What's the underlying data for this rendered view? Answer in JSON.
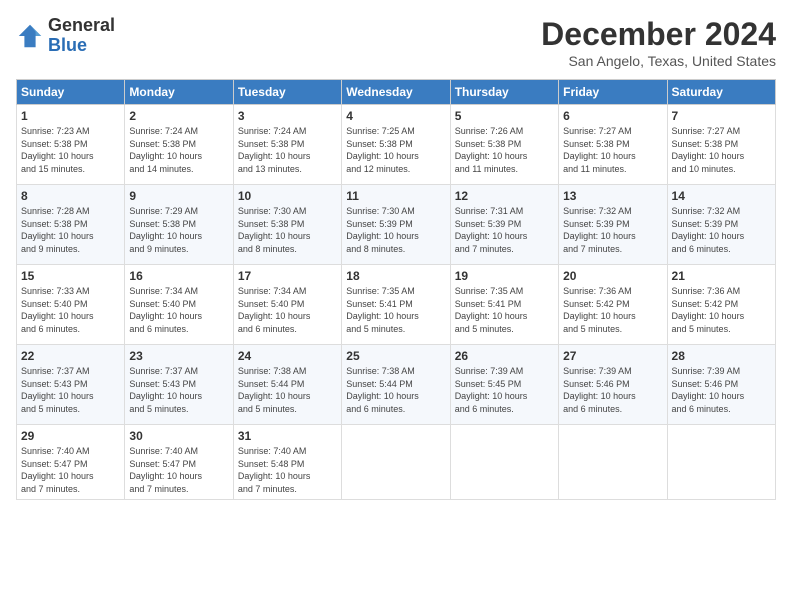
{
  "header": {
    "logo_general": "General",
    "logo_blue": "Blue",
    "month_title": "December 2024",
    "location": "San Angelo, Texas, United States"
  },
  "calendar": {
    "weekdays": [
      "Sunday",
      "Monday",
      "Tuesday",
      "Wednesday",
      "Thursday",
      "Friday",
      "Saturday"
    ],
    "weeks": [
      [
        {
          "day": "1",
          "info": "Sunrise: 7:23 AM\nSunset: 5:38 PM\nDaylight: 10 hours\nand 15 minutes."
        },
        {
          "day": "2",
          "info": "Sunrise: 7:24 AM\nSunset: 5:38 PM\nDaylight: 10 hours\nand 14 minutes."
        },
        {
          "day": "3",
          "info": "Sunrise: 7:24 AM\nSunset: 5:38 PM\nDaylight: 10 hours\nand 13 minutes."
        },
        {
          "day": "4",
          "info": "Sunrise: 7:25 AM\nSunset: 5:38 PM\nDaylight: 10 hours\nand 12 minutes."
        },
        {
          "day": "5",
          "info": "Sunrise: 7:26 AM\nSunset: 5:38 PM\nDaylight: 10 hours\nand 11 minutes."
        },
        {
          "day": "6",
          "info": "Sunrise: 7:27 AM\nSunset: 5:38 PM\nDaylight: 10 hours\nand 11 minutes."
        },
        {
          "day": "7",
          "info": "Sunrise: 7:27 AM\nSunset: 5:38 PM\nDaylight: 10 hours\nand 10 minutes."
        }
      ],
      [
        {
          "day": "8",
          "info": "Sunrise: 7:28 AM\nSunset: 5:38 PM\nDaylight: 10 hours\nand 9 minutes."
        },
        {
          "day": "9",
          "info": "Sunrise: 7:29 AM\nSunset: 5:38 PM\nDaylight: 10 hours\nand 9 minutes."
        },
        {
          "day": "10",
          "info": "Sunrise: 7:30 AM\nSunset: 5:38 PM\nDaylight: 10 hours\nand 8 minutes."
        },
        {
          "day": "11",
          "info": "Sunrise: 7:30 AM\nSunset: 5:39 PM\nDaylight: 10 hours\nand 8 minutes."
        },
        {
          "day": "12",
          "info": "Sunrise: 7:31 AM\nSunset: 5:39 PM\nDaylight: 10 hours\nand 7 minutes."
        },
        {
          "day": "13",
          "info": "Sunrise: 7:32 AM\nSunset: 5:39 PM\nDaylight: 10 hours\nand 7 minutes."
        },
        {
          "day": "14",
          "info": "Sunrise: 7:32 AM\nSunset: 5:39 PM\nDaylight: 10 hours\nand 6 minutes."
        }
      ],
      [
        {
          "day": "15",
          "info": "Sunrise: 7:33 AM\nSunset: 5:40 PM\nDaylight: 10 hours\nand 6 minutes."
        },
        {
          "day": "16",
          "info": "Sunrise: 7:34 AM\nSunset: 5:40 PM\nDaylight: 10 hours\nand 6 minutes."
        },
        {
          "day": "17",
          "info": "Sunrise: 7:34 AM\nSunset: 5:40 PM\nDaylight: 10 hours\nand 6 minutes."
        },
        {
          "day": "18",
          "info": "Sunrise: 7:35 AM\nSunset: 5:41 PM\nDaylight: 10 hours\nand 5 minutes."
        },
        {
          "day": "19",
          "info": "Sunrise: 7:35 AM\nSunset: 5:41 PM\nDaylight: 10 hours\nand 5 minutes."
        },
        {
          "day": "20",
          "info": "Sunrise: 7:36 AM\nSunset: 5:42 PM\nDaylight: 10 hours\nand 5 minutes."
        },
        {
          "day": "21",
          "info": "Sunrise: 7:36 AM\nSunset: 5:42 PM\nDaylight: 10 hours\nand 5 minutes."
        }
      ],
      [
        {
          "day": "22",
          "info": "Sunrise: 7:37 AM\nSunset: 5:43 PM\nDaylight: 10 hours\nand 5 minutes."
        },
        {
          "day": "23",
          "info": "Sunrise: 7:37 AM\nSunset: 5:43 PM\nDaylight: 10 hours\nand 5 minutes."
        },
        {
          "day": "24",
          "info": "Sunrise: 7:38 AM\nSunset: 5:44 PM\nDaylight: 10 hours\nand 5 minutes."
        },
        {
          "day": "25",
          "info": "Sunrise: 7:38 AM\nSunset: 5:44 PM\nDaylight: 10 hours\nand 6 minutes."
        },
        {
          "day": "26",
          "info": "Sunrise: 7:39 AM\nSunset: 5:45 PM\nDaylight: 10 hours\nand 6 minutes."
        },
        {
          "day": "27",
          "info": "Sunrise: 7:39 AM\nSunset: 5:46 PM\nDaylight: 10 hours\nand 6 minutes."
        },
        {
          "day": "28",
          "info": "Sunrise: 7:39 AM\nSunset: 5:46 PM\nDaylight: 10 hours\nand 6 minutes."
        }
      ],
      [
        {
          "day": "29",
          "info": "Sunrise: 7:40 AM\nSunset: 5:47 PM\nDaylight: 10 hours\nand 7 minutes."
        },
        {
          "day": "30",
          "info": "Sunrise: 7:40 AM\nSunset: 5:47 PM\nDaylight: 10 hours\nand 7 minutes."
        },
        {
          "day": "31",
          "info": "Sunrise: 7:40 AM\nSunset: 5:48 PM\nDaylight: 10 hours\nand 7 minutes."
        },
        {
          "day": "",
          "info": ""
        },
        {
          "day": "",
          "info": ""
        },
        {
          "day": "",
          "info": ""
        },
        {
          "day": "",
          "info": ""
        }
      ]
    ]
  }
}
